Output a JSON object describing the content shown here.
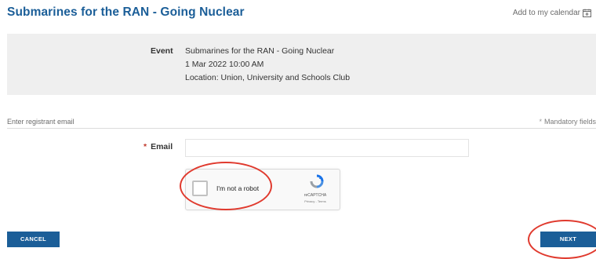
{
  "header": {
    "title": "Submarines for the RAN - Going Nuclear",
    "calendar_link": "Add to my calendar",
    "calendar_icon": "calendar-plus-icon"
  },
  "event": {
    "label": "Event",
    "name": "Submarines for the RAN - Going Nuclear",
    "datetime": "1 Mar 2022 10:00 AM",
    "location": "Location: Union, University and Schools Club"
  },
  "form": {
    "section_label": "Enter registrant email",
    "mandatory_star": "*",
    "mandatory_note": "Mandatory fields",
    "email_required_marker": "*",
    "email_label": "Email",
    "email_value": "",
    "email_placeholder": ""
  },
  "recaptcha": {
    "label": "I'm not a robot",
    "brand": "reCAPTCHA",
    "terms": "Privacy - Terms",
    "checked": false
  },
  "buttons": {
    "cancel": "CANCEL",
    "next": "NEXT"
  },
  "colors": {
    "primary": "#1b5e98",
    "annotation": "#e03a2e",
    "panel": "#efefef"
  }
}
